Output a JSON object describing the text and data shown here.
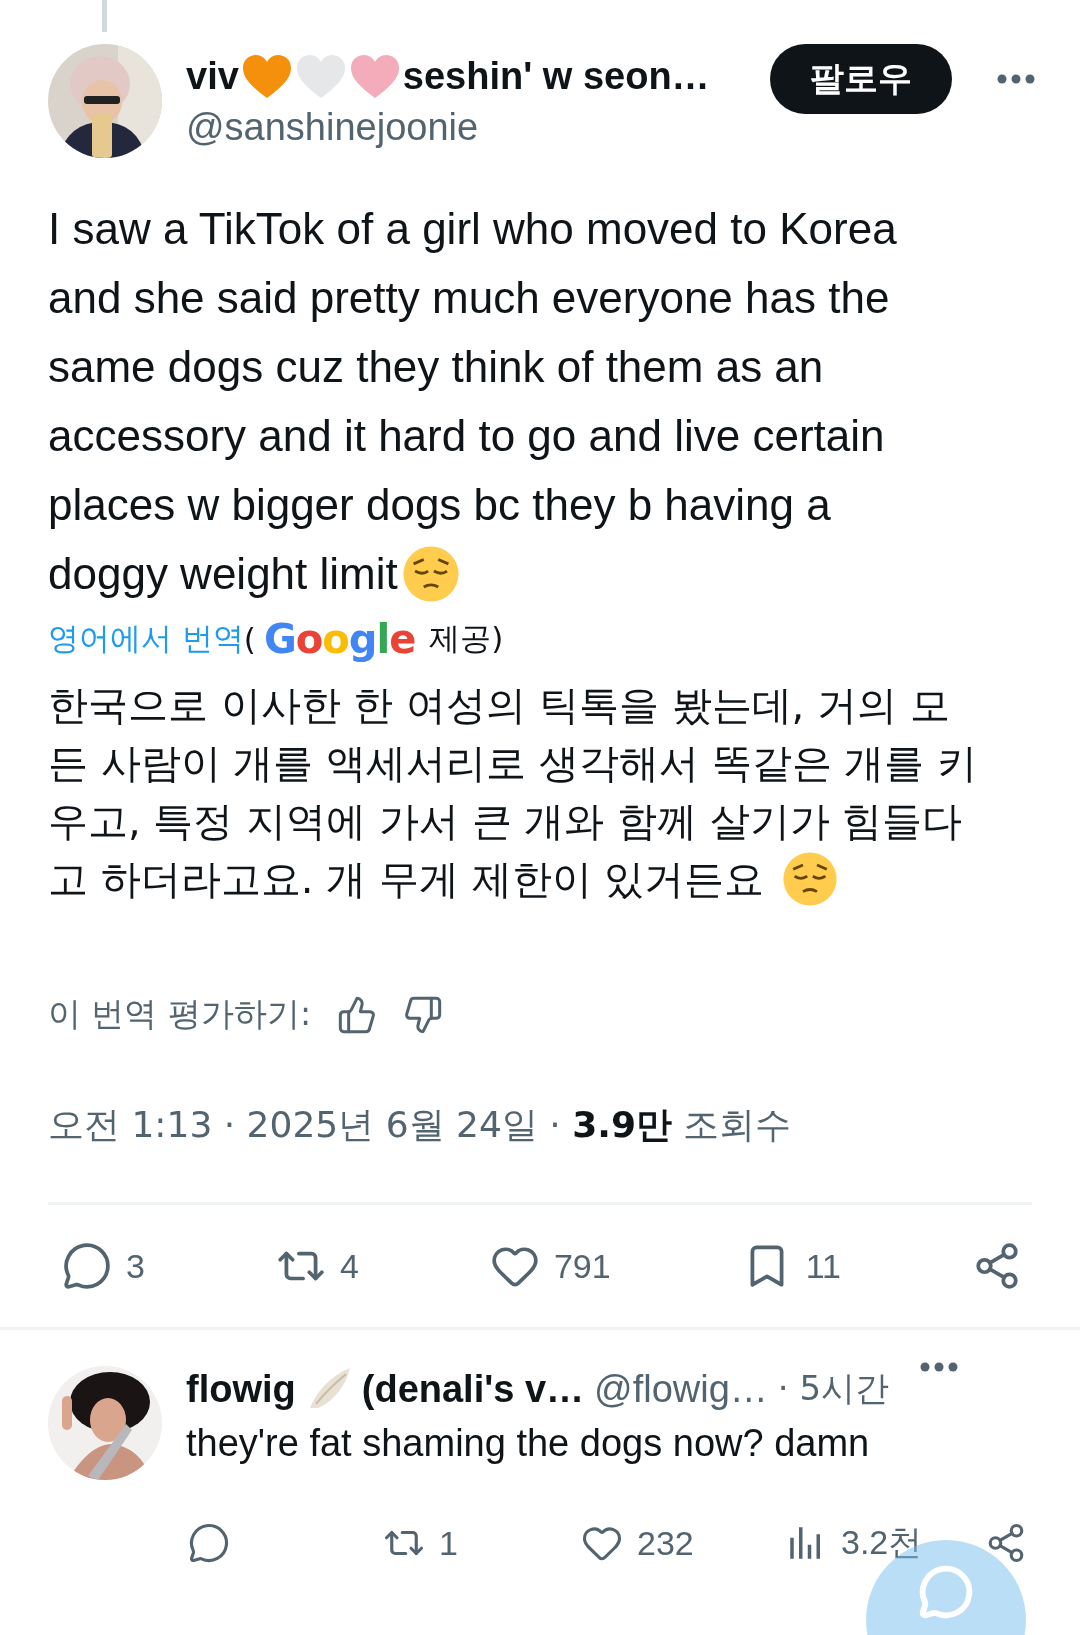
{
  "tweet": {
    "author": {
      "name_start": "viv",
      "name_emojis": [
        {
          "color": "#f4900c"
        },
        {
          "color": "#e6e7e8"
        },
        {
          "color": "#f4abba"
        }
      ],
      "name_end": "seshin' w seon…",
      "handle": "@sanshinejoonie"
    },
    "follow_button": "팔로우",
    "text_lines": [
      "I saw a TikTok of a girl who moved to Korea",
      "and she said pretty much everyone has the",
      "same dogs cuz they think of them as an",
      "accessory and it hard to go and live certain",
      "places w bigger dogs bc they b having a",
      "doggy weight limit"
    ],
    "translation": {
      "label": "영어에서 번역",
      "open_paren": "(",
      "provider": "Google",
      "suffix": "제공)",
      "text_lines": [
        "한국으로 이사한 한 여성의 틱톡을 봤는데, 거의 모",
        "든 사람이 개를 액세서리로 생각해서 똑같은 개를 키",
        "우고, 특정 지역에 가서 큰 개와 함께 살기가 힘들다",
        "고 하더라고요. 개 무게 제한이 있거든요"
      ],
      "rate_label": "이 번역 평가하기:"
    },
    "meta": "오전 1:13 · 2025년 6월 24일 · **3.9만** 조회수",
    "actions": [
      {
        "kind": "reply",
        "count": "3"
      },
      {
        "kind": "retweet",
        "count": "4"
      },
      {
        "kind": "like",
        "count": "791"
      },
      {
        "kind": "bookmark",
        "count": "11"
      },
      {
        "kind": "share"
      }
    ]
  },
  "reply": {
    "name": "flowig",
    "name_rest": "(denali's v…",
    "handle": "@flowig…",
    "time": "· 5시간",
    "text": "they're fat shaming the dogs now? damn",
    "actions": [
      {
        "kind": "reply"
      },
      {
        "kind": "retweet",
        "count": "1"
      },
      {
        "kind": "like",
        "count": "232"
      },
      {
        "kind": "views",
        "count": "3.2천"
      },
      {
        "kind": "share"
      }
    ]
  }
}
